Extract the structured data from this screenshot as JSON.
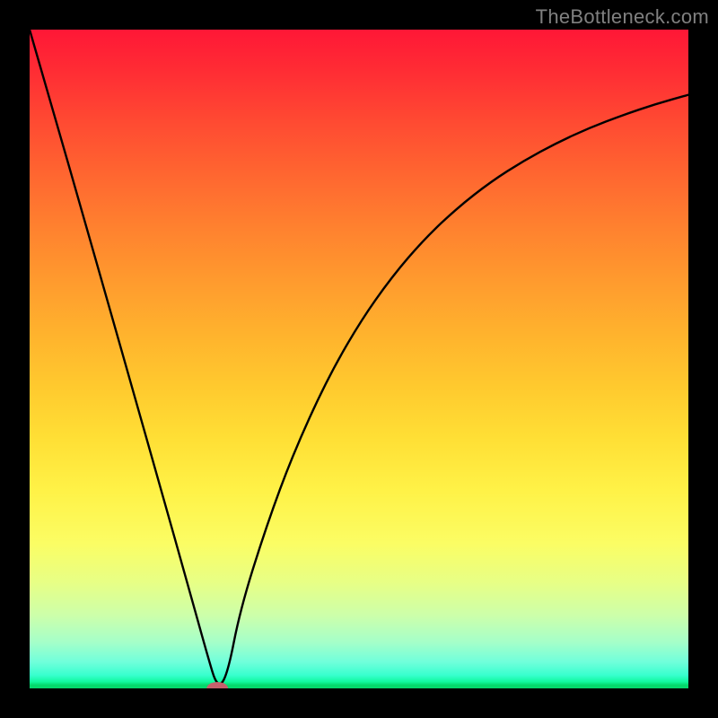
{
  "watermark": "TheBottleneck.com",
  "chart_data": {
    "type": "line",
    "title": "",
    "xlabel": "",
    "ylabel": "",
    "xlim": [
      0,
      1
    ],
    "ylim": [
      0,
      1
    ],
    "min_x": 0.285,
    "series": [
      {
        "name": "left-branch",
        "x": [
          0.0,
          0.04,
          0.08,
          0.12,
          0.16,
          0.2,
          0.24,
          0.27,
          0.285,
          0.3
        ],
        "y": [
          1.0,
          0.862,
          0.722,
          0.582,
          0.441,
          0.3,
          0.158,
          0.05,
          0.0,
          0.019
        ]
      },
      {
        "name": "right-branch",
        "x": [
          0.285,
          0.32,
          0.36,
          0.4,
          0.45,
          0.5,
          0.55,
          0.6,
          0.65,
          0.7,
          0.75,
          0.8,
          0.85,
          0.9,
          0.95,
          1.0
        ],
        "y": [
          0.0,
          0.121,
          0.248,
          0.356,
          0.466,
          0.554,
          0.625,
          0.683,
          0.73,
          0.769,
          0.801,
          0.828,
          0.851,
          0.87,
          0.887,
          0.901
        ]
      }
    ],
    "marker": {
      "x": 0.285,
      "y": 0.0,
      "color": "#c6606c",
      "rx": 12,
      "ry": 7
    },
    "gradient_stops": [
      {
        "pos": 0.0,
        "color": "#ff1736"
      },
      {
        "pos": 0.5,
        "color": "#ffc92e"
      },
      {
        "pos": 0.8,
        "color": "#f6ff74"
      },
      {
        "pos": 1.0,
        "color": "#05d86c"
      }
    ]
  }
}
